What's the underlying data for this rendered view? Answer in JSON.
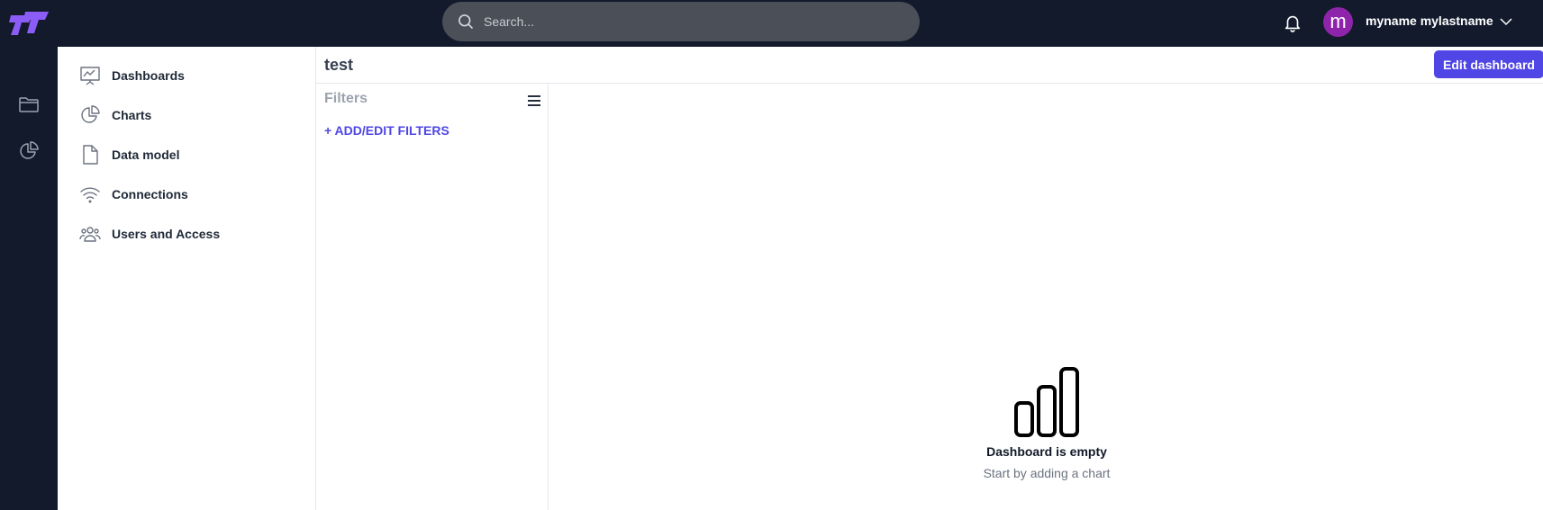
{
  "topbar": {
    "search_placeholder": "Search...",
    "username": "myname mylastname",
    "avatar_letter": "m",
    "avatar_color": "#8e24aa",
    "logo_color": "#8b5cf6",
    "background_color": "#121a2c"
  },
  "rail": {
    "icons": [
      "folder-icon",
      "pie-chart-icon"
    ]
  },
  "sidebar": {
    "items": [
      {
        "label": "Dashboards",
        "icon": "presentation-chart-icon"
      },
      {
        "label": "Charts",
        "icon": "pie-chart-icon"
      },
      {
        "label": "Data model",
        "icon": "document-icon"
      },
      {
        "label": "Connections",
        "icon": "wifi-icon"
      },
      {
        "label": "Users and Access",
        "icon": "users-group-icon"
      }
    ]
  },
  "main": {
    "title": "test",
    "edit_button_label": "Edit dashboard",
    "accent_color": "#4f46e5"
  },
  "filters": {
    "title": "Filters",
    "add_label": "+ ADD/EDIT FILTERS"
  },
  "empty_state": {
    "icon": "bar-chart-icon",
    "title": "Dashboard is empty",
    "subtitle": "Start by adding a chart"
  }
}
